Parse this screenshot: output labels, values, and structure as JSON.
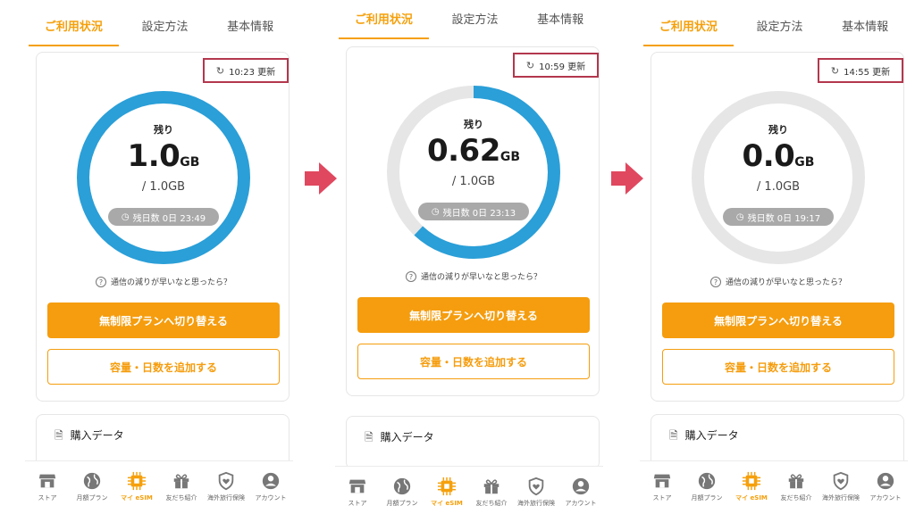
{
  "tabs": [
    "ご利用状況",
    "設定方法",
    "基本情報"
  ],
  "screens": [
    {
      "update_time": "10:23 更新",
      "remaining_label": "残り",
      "remaining_value": "1.0",
      "remaining_unit": "GB",
      "remaining_fraction": 1.0,
      "total": "/ 1.0GB",
      "days_left": "残日数 0日 23:49"
    },
    {
      "update_time": "10:59 更新",
      "remaining_label": "残り",
      "remaining_value": "0.62",
      "remaining_unit": "GB",
      "remaining_fraction": 0.62,
      "total": "/ 1.0GB",
      "days_left": "残日数 0日 23:13"
    },
    {
      "update_time": "14:55 更新",
      "remaining_label": "残り",
      "remaining_value": "0.0",
      "remaining_unit": "GB",
      "remaining_fraction": 0.0,
      "total": "/ 1.0GB",
      "days_left": "残日数 0日 19:17"
    }
  ],
  "hint": "通信の減りが早いなと思ったら？",
  "primary_button": "無制限プランへ切り替える",
  "secondary_button": "容量・日数を追加する",
  "purchase_title": "購入データ",
  "nav": [
    {
      "label": "ストア",
      "icon": "store-icon"
    },
    {
      "label": "月額プラン",
      "icon": "globe-icon"
    },
    {
      "label": "マイ eSIM",
      "icon": "chip-icon"
    },
    {
      "label": "友だち紹介",
      "icon": "gift-icon"
    },
    {
      "label": "海外旅行保険",
      "icon": "shield-heart-icon"
    },
    {
      "label": "アカウント",
      "icon": "account-icon"
    }
  ],
  "colors": {
    "accent": "#f59d0e",
    "ring_fill": "#2a9fd8",
    "ring_track": "#e6e6e6",
    "highlight_box": "#b3374d",
    "arrow": "#e0485f"
  }
}
